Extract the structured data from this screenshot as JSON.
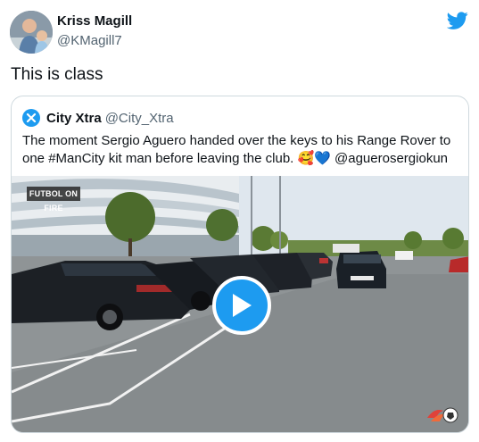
{
  "author": {
    "name": "Kriss Magill",
    "handle": "@KMagill7"
  },
  "tweet": {
    "text": "This is class"
  },
  "quoted": {
    "name": "City Xtra",
    "handle": "@City_Xtra",
    "text": "The moment Sergio Aguero handed over the keys to his Range Rover to one #ManCity kit man before leaving the club. 🥰💙 @aguerosergiokun"
  },
  "video": {
    "watermark": "FUTBOL ON FIRE"
  },
  "colors": {
    "accent": "#1d9bf0",
    "name": "#0f1419",
    "secondary": "#536471",
    "border": "#cfd9de"
  },
  "icons": [
    "twitter-bird-icon",
    "play-icon",
    "city-xtra-logo-icon"
  ]
}
